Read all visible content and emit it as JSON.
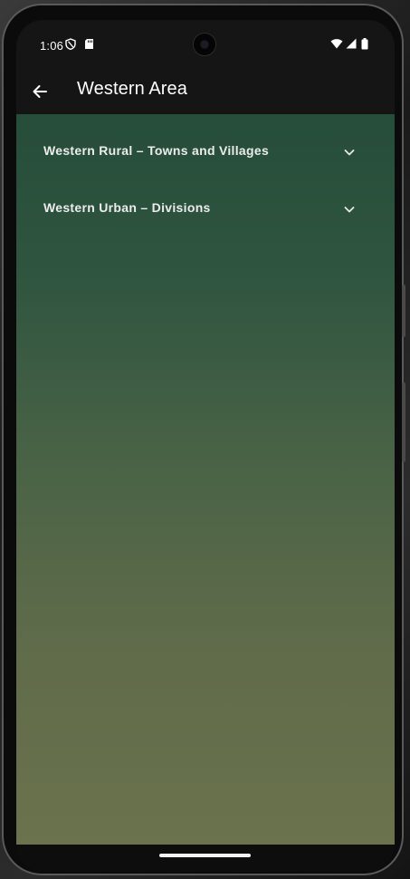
{
  "status_bar": {
    "time": "1:06"
  },
  "app_bar": {
    "title": "Western Area",
    "back_icon": "arrow-back-icon"
  },
  "sections": [
    {
      "label": "Western Rural – Towns and Villages",
      "icon": "chevron-down-icon",
      "expanded": false
    },
    {
      "label": "Western Urban – Divisions",
      "icon": "chevron-down-icon",
      "expanded": false
    }
  ],
  "colors": {
    "app_bar": "#151515",
    "gradient_top": "#264d3a",
    "gradient_bottom": "#6b724d",
    "text": "#ececec"
  }
}
